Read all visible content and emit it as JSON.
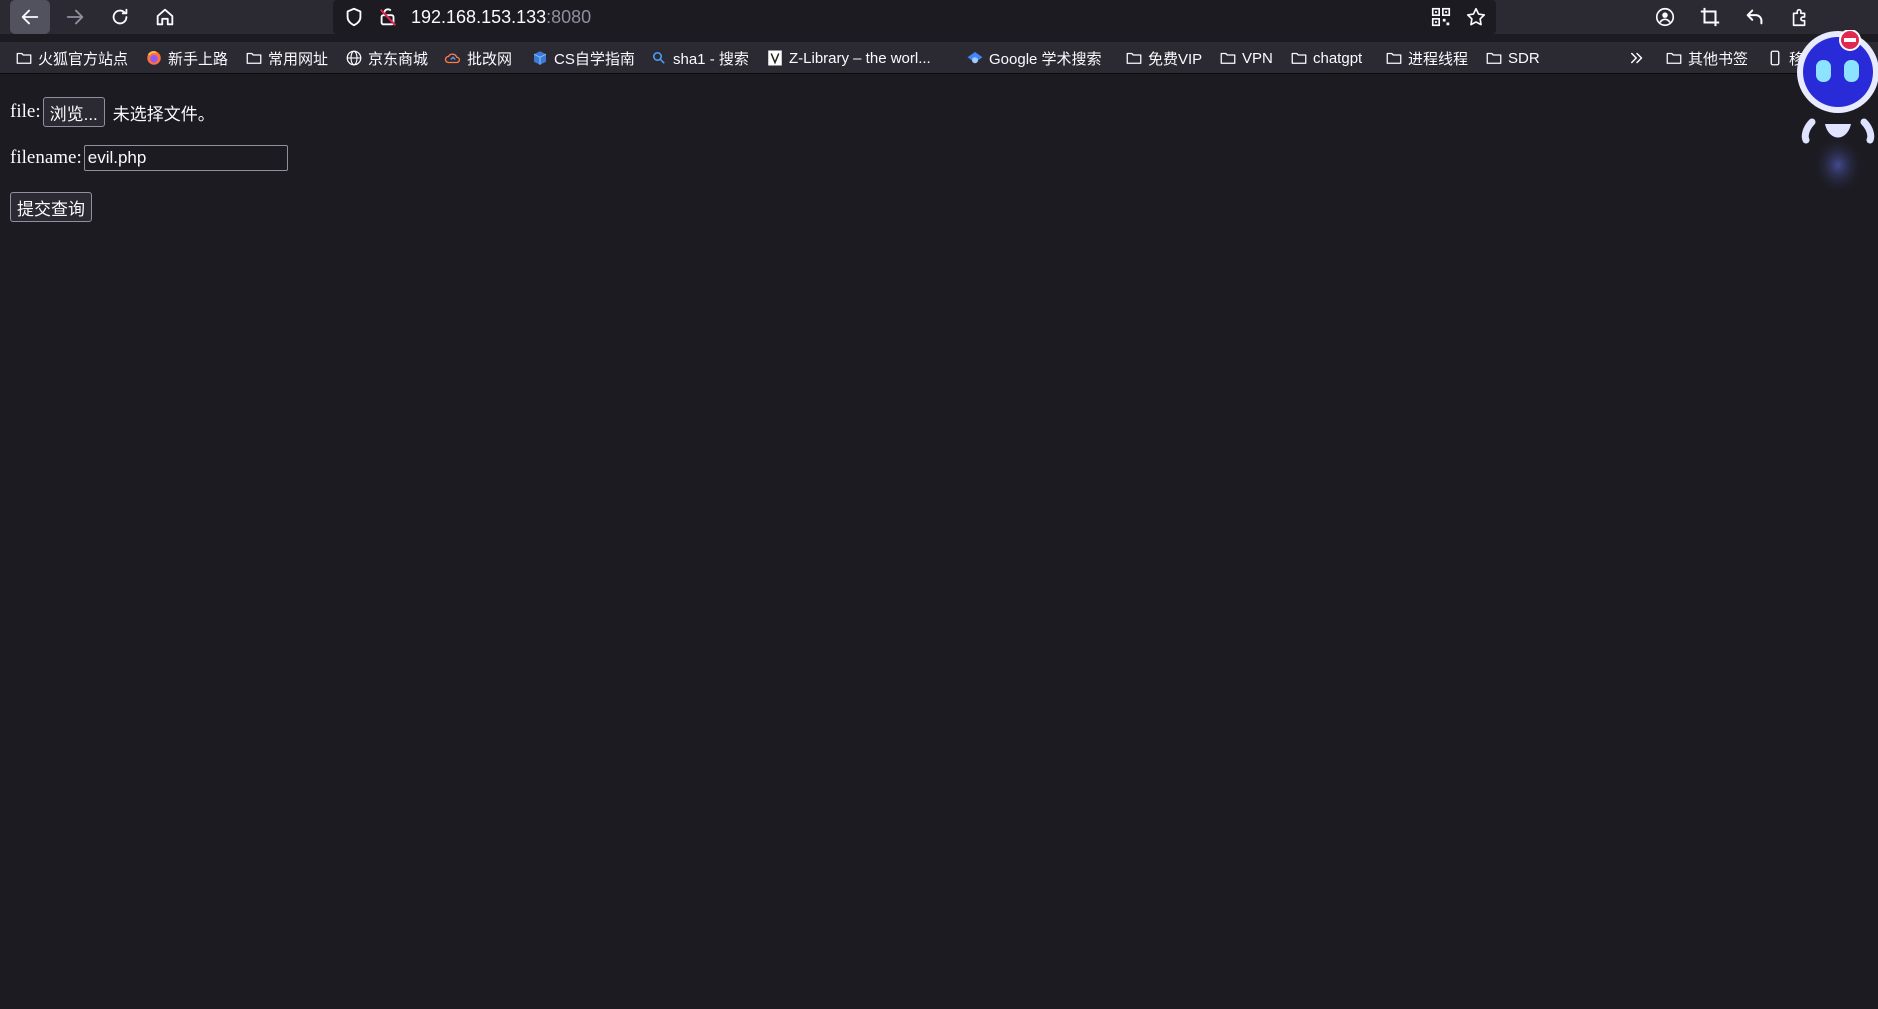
{
  "browser": {
    "url_host": "192.168.153.133",
    "url_port": ":8080",
    "bookmarks": [
      {
        "label": "火狐官方站点",
        "icon": "folder-icon"
      },
      {
        "label": "新手上路",
        "icon": "firefox-icon"
      },
      {
        "label": "常用网址",
        "icon": "folder-icon"
      },
      {
        "label": "京东商城",
        "icon": "globe-icon"
      },
      {
        "label": "批改网",
        "icon": "cloud-icon"
      },
      {
        "label": "CS自学指南",
        "icon": "cube-icon"
      },
      {
        "label": "sha1 - 搜索",
        "icon": "search-icon"
      },
      {
        "label": "Z-Library – the worl...",
        "icon": "zlibrary-icon"
      },
      {
        "label": "Google 学术搜索",
        "icon": "scholar-icon"
      },
      {
        "label": "免费VIP",
        "icon": "folder-icon"
      },
      {
        "label": "VPN",
        "icon": "folder-icon"
      },
      {
        "label": "chatgpt",
        "icon": "folder-icon"
      },
      {
        "label": "进程线程",
        "icon": "folder-icon"
      },
      {
        "label": "SDR",
        "icon": "folder-icon"
      }
    ],
    "other_bookmarks": "其他书签",
    "mobile_bookmarks": "移"
  },
  "form": {
    "file_label": "file:",
    "browse_label": "浏览...",
    "no_file_text": "未选择文件。",
    "filename_label": "filename:",
    "filename_value": "evil.php",
    "submit_label": "提交查询"
  }
}
